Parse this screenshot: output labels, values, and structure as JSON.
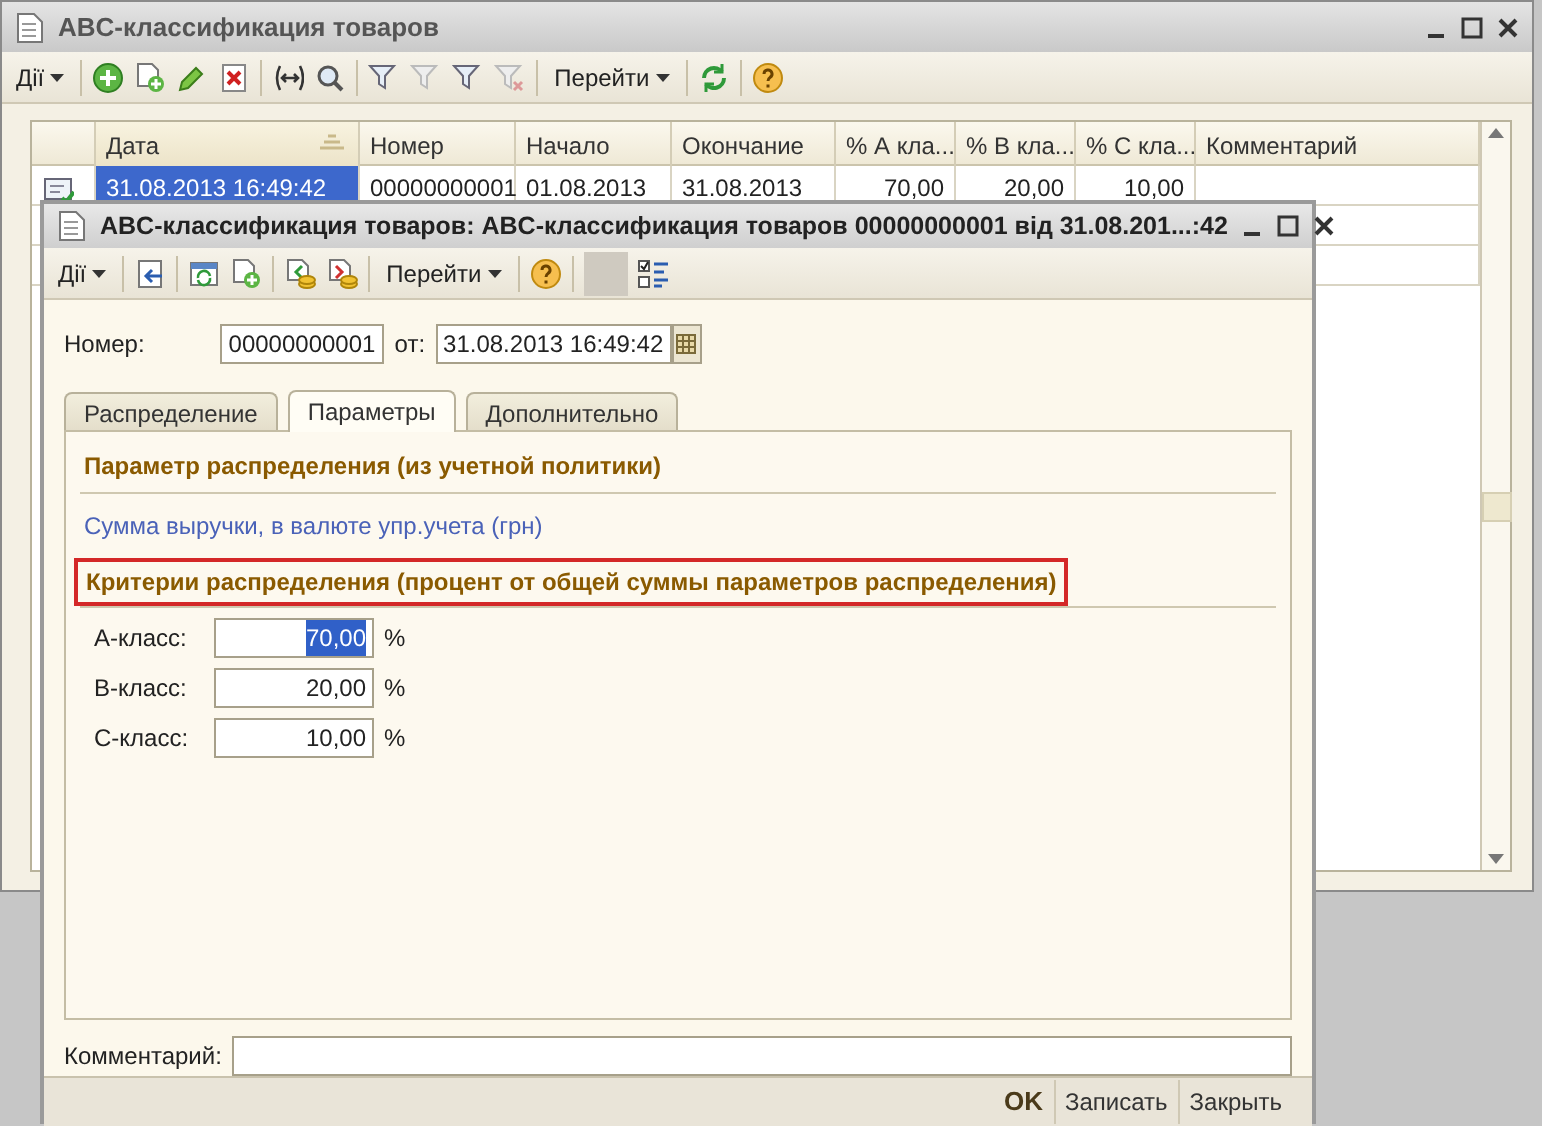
{
  "main_window": {
    "title": "ABC-классификация товаров",
    "toolbar": {
      "actions": "Дії",
      "goto": "Перейти"
    },
    "table": {
      "columns": [
        {
          "label": "Дата",
          "sorted": true
        },
        {
          "label": "Номер",
          "sorted": false
        },
        {
          "label": "Начало",
          "sorted": false
        },
        {
          "label": "Окончание",
          "sorted": false
        },
        {
          "label": "% А кла...",
          "sorted": false
        },
        {
          "label": "% В кла...",
          "sorted": false
        },
        {
          "label": "% С кла...",
          "sorted": false
        },
        {
          "label": "Комментарий",
          "sorted": false
        }
      ],
      "rows": [
        {
          "selected": true,
          "cells": [
            "31.08.2013 16:49:42",
            "00000000001",
            "01.08.2013",
            "31.08.2013",
            "70,00",
            "20,00",
            "10,00"
          ]
        }
      ]
    }
  },
  "dialog": {
    "title": "ABC-классификация товаров: ABC-классификация товаров 00000000001 від 31.08.201...:42",
    "toolbar": {
      "actions": "Дії",
      "goto": "Перейти"
    },
    "number_label": "Номер:",
    "number": "00000000001",
    "date_label": "от:",
    "date": "31.08.2013 16:49:42",
    "tabs": [
      {
        "label": "Распределение",
        "selected": false
      },
      {
        "label": "Параметры",
        "selected": true
      },
      {
        "label": "Дополнительно",
        "selected": false
      }
    ],
    "sections": [
      {
        "heading": "Параметр распределения (из учетной политики)",
        "highlighted": false,
        "value": "Сумма выручки, в валюте упр.учета (грн)"
      },
      {
        "heading": "Критерии распределения (процент от общей суммы параметров распределения)",
        "highlighted": true,
        "fields": [
          {
            "label": "А-класс:",
            "value": "70,00",
            "unit": "%",
            "selected": true
          },
          {
            "label": "В-класс:",
            "value": "20,00",
            "unit": "%",
            "selected": false
          },
          {
            "label": "С-класс:",
            "value": "10,00",
            "unit": "%",
            "selected": false
          }
        ]
      }
    ],
    "comment_label": "Комментарий:",
    "buttons": [
      {
        "label": "OK",
        "kind": "default"
      },
      {
        "label": "Записать",
        "kind": "normal"
      },
      {
        "label": "Закрыть",
        "kind": "normal"
      }
    ]
  }
}
